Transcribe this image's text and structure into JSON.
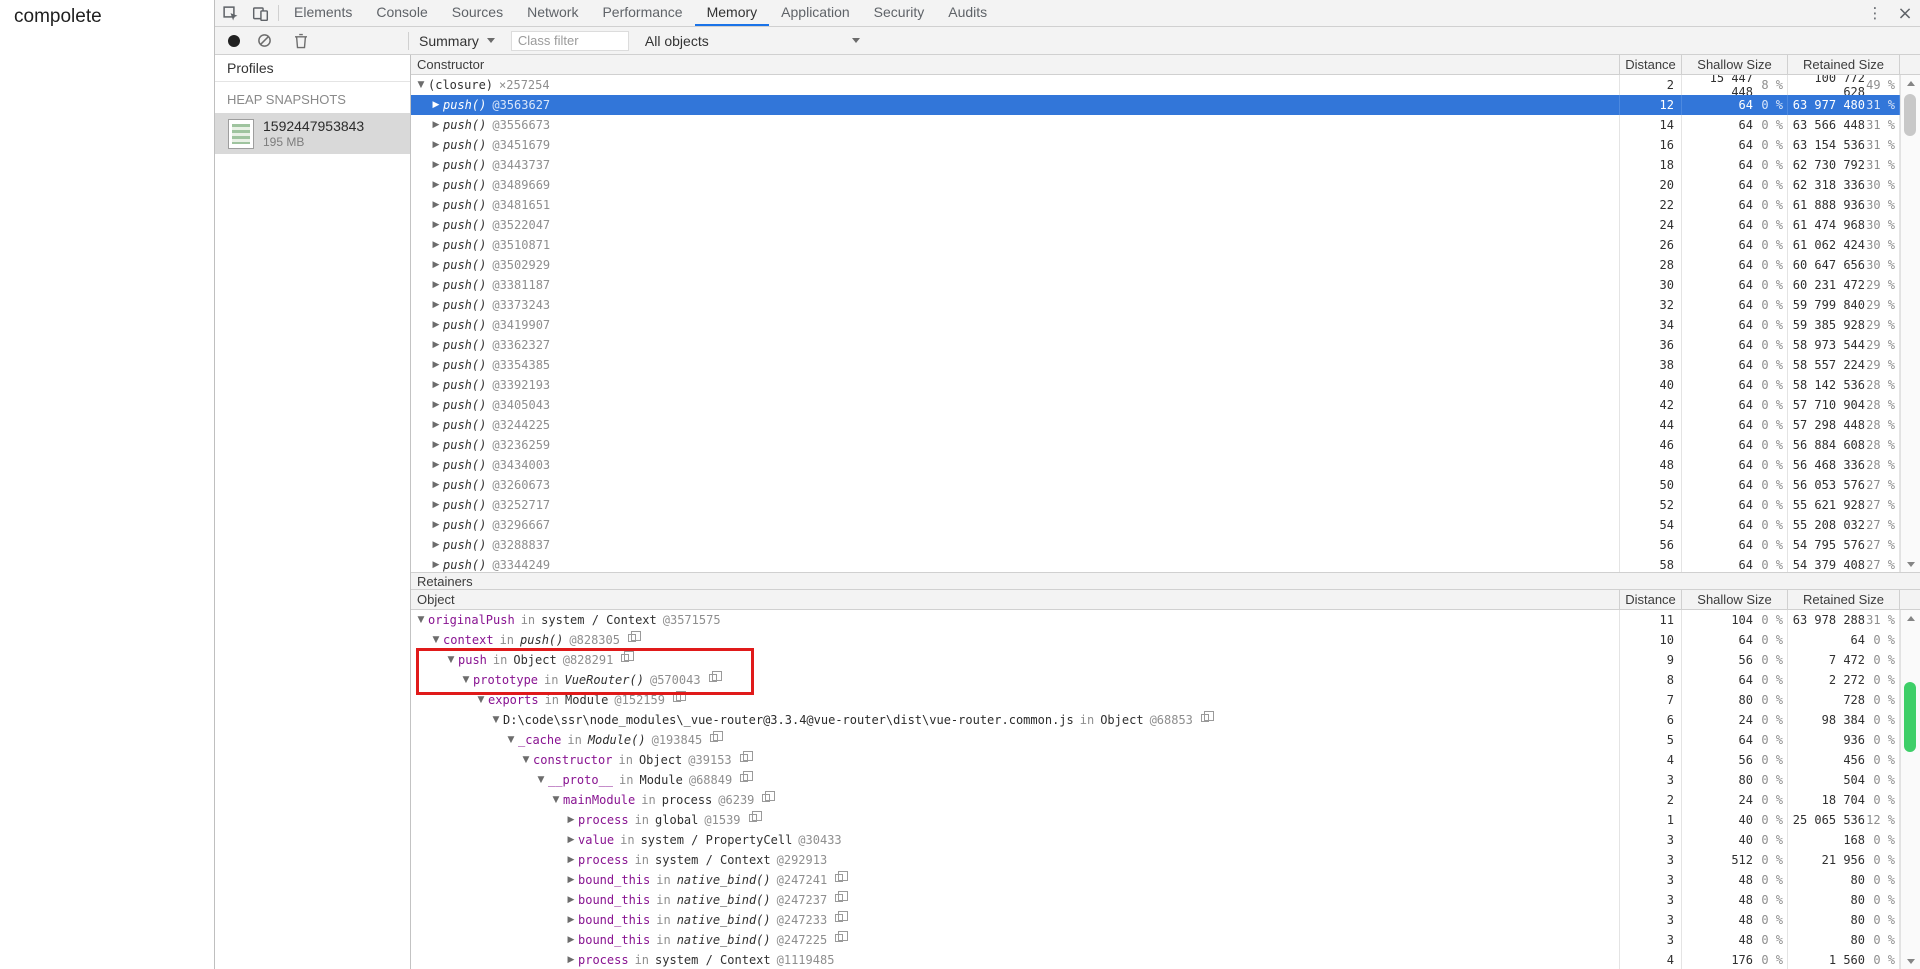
{
  "page": {
    "text": "compolete"
  },
  "colors": {
    "accent_blue": "#1a73e8",
    "selection_blue": "#3276d9",
    "property_name_purple": "#881391",
    "annotation_red": "#e01a1a",
    "scroll_thumb_green": "#3ecf68",
    "toolbar_gray": "#f3f3f3"
  },
  "icons": {
    "tabbar": [
      "inspect-icon",
      "device-toolbar-icon"
    ],
    "toolbar": [
      "record-icon",
      "clear-icon",
      "delete-icon"
    ],
    "window": [
      "menu-icon",
      "close-icon"
    ]
  },
  "devtools": {
    "tabs": [
      {
        "label": "Elements",
        "active": false
      },
      {
        "label": "Console",
        "active": false
      },
      {
        "label": "Sources",
        "active": false
      },
      {
        "label": "Network",
        "active": false
      },
      {
        "label": "Performance",
        "active": false
      },
      {
        "label": "Memory",
        "active": true
      },
      {
        "label": "Application",
        "active": false
      },
      {
        "label": "Security",
        "active": false
      },
      {
        "label": "Audits",
        "active": false
      }
    ],
    "window_controls": {
      "menu": "⋮",
      "close": "×"
    },
    "toolbar": {
      "summary_label": "Summary",
      "class_filter_placeholder": "Class filter",
      "all_objects_label": "All objects"
    },
    "sidebar": {
      "title": "Profiles",
      "section": "HEAP SNAPSHOTS",
      "snapshot": {
        "name": "1592447953843",
        "size": "195 MB"
      }
    },
    "constructor_panel": {
      "columns": [
        "Constructor",
        "Distance",
        "Shallow Size",
        "Retained Size"
      ],
      "rows": [
        {
          "marker": "▼",
          "indent": 0,
          "name": "(closure)",
          "fn": false,
          "count": "×257254",
          "id": "",
          "dist": "2",
          "shallow": "15 447 448",
          "shallow_pct": "8 %",
          "retained": "100 772 628",
          "retained_pct": "49 %",
          "selected": false
        },
        {
          "marker": "▶",
          "indent": 1,
          "name": "push()",
          "fn": true,
          "count": "",
          "id": "@3563627",
          "dist": "12",
          "shallow": "64",
          "shallow_pct": "0 %",
          "retained": "63 977 480",
          "retained_pct": "31 %",
          "selected": true
        },
        {
          "marker": "▶",
          "indent": 1,
          "name": "push()",
          "fn": true,
          "count": "",
          "id": "@3556673",
          "dist": "14",
          "shallow": "64",
          "shallow_pct": "0 %",
          "retained": "63 566 448",
          "retained_pct": "31 %",
          "selected": false
        },
        {
          "marker": "▶",
          "indent": 1,
          "name": "push()",
          "fn": true,
          "count": "",
          "id": "@3451679",
          "dist": "16",
          "shallow": "64",
          "shallow_pct": "0 %",
          "retained": "63 154 536",
          "retained_pct": "31 %",
          "selected": false
        },
        {
          "marker": "▶",
          "indent": 1,
          "name": "push()",
          "fn": true,
          "count": "",
          "id": "@3443737",
          "dist": "18",
          "shallow": "64",
          "shallow_pct": "0 %",
          "retained": "62 730 792",
          "retained_pct": "31 %",
          "selected": false
        },
        {
          "marker": "▶",
          "indent": 1,
          "name": "push()",
          "fn": true,
          "count": "",
          "id": "@3489669",
          "dist": "20",
          "shallow": "64",
          "shallow_pct": "0 %",
          "retained": "62 318 336",
          "retained_pct": "30 %",
          "selected": false
        },
        {
          "marker": "▶",
          "indent": 1,
          "name": "push()",
          "fn": true,
          "count": "",
          "id": "@3481651",
          "dist": "22",
          "shallow": "64",
          "shallow_pct": "0 %",
          "retained": "61 888 936",
          "retained_pct": "30 %",
          "selected": false
        },
        {
          "marker": "▶",
          "indent": 1,
          "name": "push()",
          "fn": true,
          "count": "",
          "id": "@3522047",
          "dist": "24",
          "shallow": "64",
          "shallow_pct": "0 %",
          "retained": "61 474 968",
          "retained_pct": "30 %",
          "selected": false
        },
        {
          "marker": "▶",
          "indent": 1,
          "name": "push()",
          "fn": true,
          "count": "",
          "id": "@3510871",
          "dist": "26",
          "shallow": "64",
          "shallow_pct": "0 %",
          "retained": "61 062 424",
          "retained_pct": "30 %",
          "selected": false
        },
        {
          "marker": "▶",
          "indent": 1,
          "name": "push()",
          "fn": true,
          "count": "",
          "id": "@3502929",
          "dist": "28",
          "shallow": "64",
          "shallow_pct": "0 %",
          "retained": "60 647 656",
          "retained_pct": "30 %",
          "selected": false
        },
        {
          "marker": "▶",
          "indent": 1,
          "name": "push()",
          "fn": true,
          "count": "",
          "id": "@3381187",
          "dist": "30",
          "shallow": "64",
          "shallow_pct": "0 %",
          "retained": "60 231 472",
          "retained_pct": "29 %",
          "selected": false
        },
        {
          "marker": "▶",
          "indent": 1,
          "name": "push()",
          "fn": true,
          "count": "",
          "id": "@3373243",
          "dist": "32",
          "shallow": "64",
          "shallow_pct": "0 %",
          "retained": "59 799 840",
          "retained_pct": "29 %",
          "selected": false
        },
        {
          "marker": "▶",
          "indent": 1,
          "name": "push()",
          "fn": true,
          "count": "",
          "id": "@3419907",
          "dist": "34",
          "shallow": "64",
          "shallow_pct": "0 %",
          "retained": "59 385 928",
          "retained_pct": "29 %",
          "selected": false
        },
        {
          "marker": "▶",
          "indent": 1,
          "name": "push()",
          "fn": true,
          "count": "",
          "id": "@3362327",
          "dist": "36",
          "shallow": "64",
          "shallow_pct": "0 %",
          "retained": "58 973 544",
          "retained_pct": "29 %",
          "selected": false
        },
        {
          "marker": "▶",
          "indent": 1,
          "name": "push()",
          "fn": true,
          "count": "",
          "id": "@3354385",
          "dist": "38",
          "shallow": "64",
          "shallow_pct": "0 %",
          "retained": "58 557 224",
          "retained_pct": "29 %",
          "selected": false
        },
        {
          "marker": "▶",
          "indent": 1,
          "name": "push()",
          "fn": true,
          "count": "",
          "id": "@3392193",
          "dist": "40",
          "shallow": "64",
          "shallow_pct": "0 %",
          "retained": "58 142 536",
          "retained_pct": "28 %",
          "selected": false
        },
        {
          "marker": "▶",
          "indent": 1,
          "name": "push()",
          "fn": true,
          "count": "",
          "id": "@3405043",
          "dist": "42",
          "shallow": "64",
          "shallow_pct": "0 %",
          "retained": "57 710 904",
          "retained_pct": "28 %",
          "selected": false
        },
        {
          "marker": "▶",
          "indent": 1,
          "name": "push()",
          "fn": true,
          "count": "",
          "id": "@3244225",
          "dist": "44",
          "shallow": "64",
          "shallow_pct": "0 %",
          "retained": "57 298 448",
          "retained_pct": "28 %",
          "selected": false
        },
        {
          "marker": "▶",
          "indent": 1,
          "name": "push()",
          "fn": true,
          "count": "",
          "id": "@3236259",
          "dist": "46",
          "shallow": "64",
          "shallow_pct": "0 %",
          "retained": "56 884 608",
          "retained_pct": "28 %",
          "selected": false
        },
        {
          "marker": "▶",
          "indent": 1,
          "name": "push()",
          "fn": true,
          "count": "",
          "id": "@3434003",
          "dist": "48",
          "shallow": "64",
          "shallow_pct": "0 %",
          "retained": "56 468 336",
          "retained_pct": "28 %",
          "selected": false
        },
        {
          "marker": "▶",
          "indent": 1,
          "name": "push()",
          "fn": true,
          "count": "",
          "id": "@3260673",
          "dist": "50",
          "shallow": "64",
          "shallow_pct": "0 %",
          "retained": "56 053 576",
          "retained_pct": "27 %",
          "selected": false
        },
        {
          "marker": "▶",
          "indent": 1,
          "name": "push()",
          "fn": true,
          "count": "",
          "id": "@3252717",
          "dist": "52",
          "shallow": "64",
          "shallow_pct": "0 %",
          "retained": "55 621 928",
          "retained_pct": "27 %",
          "selected": false
        },
        {
          "marker": "▶",
          "indent": 1,
          "name": "push()",
          "fn": true,
          "count": "",
          "id": "@3296667",
          "dist": "54",
          "shallow": "64",
          "shallow_pct": "0 %",
          "retained": "55 208 032",
          "retained_pct": "27 %",
          "selected": false
        },
        {
          "marker": "▶",
          "indent": 1,
          "name": "push()",
          "fn": true,
          "count": "",
          "id": "@3288837",
          "dist": "56",
          "shallow": "64",
          "shallow_pct": "0 %",
          "retained": "54 795 576",
          "retained_pct": "27 %",
          "selected": false
        },
        {
          "marker": "▶",
          "indent": 1,
          "name": "push()",
          "fn": true,
          "count": "",
          "id": "@3344249",
          "dist": "58",
          "shallow": "64",
          "shallow_pct": "0 %",
          "retained": "54 379 408",
          "retained_pct": "27 %",
          "selected": false
        }
      ]
    },
    "retainers_panel": {
      "title": "Retainers",
      "columns": [
        "Object",
        "Distance",
        "Shallow Size",
        "Retained Size"
      ],
      "rows": [
        {
          "marker": "▼",
          "indent": 0,
          "prop": "originalPush",
          "prop_style": "name",
          "obj": "system / Context",
          "obj_fn": false,
          "id": "@3571575",
          "reveal": false,
          "dist": "11",
          "shallow": "104",
          "shallow_pct": "0 %",
          "retained": "63 978 288",
          "retained_pct": "31 %"
        },
        {
          "marker": "▼",
          "indent": 1,
          "prop": "context",
          "prop_style": "name",
          "obj": "push()",
          "obj_fn": true,
          "id": "@828305",
          "reveal": true,
          "dist": "10",
          "shallow": "64",
          "shallow_pct": "0 %",
          "retained": "64",
          "retained_pct": "0 %"
        },
        {
          "marker": "▼",
          "indent": 2,
          "prop": "push",
          "prop_style": "name",
          "obj": "Object",
          "obj_fn": false,
          "id": "@828291",
          "reveal": true,
          "dist": "9",
          "shallow": "56",
          "shallow_pct": "0 %",
          "retained": "7 472",
          "retained_pct": "0 %"
        },
        {
          "marker": "▼",
          "indent": 3,
          "prop": "prototype",
          "prop_style": "name",
          "obj": "VueRouter()",
          "obj_fn": true,
          "id": "@570043",
          "reveal": true,
          "dist": "8",
          "shallow": "64",
          "shallow_pct": "0 %",
          "retained": "2 272",
          "retained_pct": "0 %"
        },
        {
          "marker": "▼",
          "indent": 4,
          "prop": "exports",
          "prop_style": "name",
          "obj": "Module",
          "obj_fn": false,
          "id": "@152159",
          "reveal": true,
          "dist": "7",
          "shallow": "80",
          "shallow_pct": "0 %",
          "retained": "728",
          "retained_pct": "0 %"
        },
        {
          "marker": "▼",
          "indent": 5,
          "prop": "D:\\code\\ssr\\node_modules\\_vue-router@3.3.4@vue-router\\dist\\vue-router.common.js",
          "prop_style": "path",
          "obj": "Object",
          "obj_fn": false,
          "id": "@68853",
          "reveal": true,
          "dist": "6",
          "shallow": "24",
          "shallow_pct": "0 %",
          "retained": "98 384",
          "retained_pct": "0 %"
        },
        {
          "marker": "▼",
          "indent": 6,
          "prop": "_cache",
          "prop_style": "name",
          "obj": "Module()",
          "obj_fn": true,
          "id": "@193845",
          "reveal": true,
          "dist": "5",
          "shallow": "64",
          "shallow_pct": "0 %",
          "retained": "936",
          "retained_pct": "0 %"
        },
        {
          "marker": "▼",
          "indent": 7,
          "prop": "constructor",
          "prop_style": "name",
          "obj": "Object",
          "obj_fn": false,
          "id": "@39153",
          "reveal": true,
          "dist": "4",
          "shallow": "56",
          "shallow_pct": "0 %",
          "retained": "456",
          "retained_pct": "0 %"
        },
        {
          "marker": "▼",
          "indent": 8,
          "prop": "__proto__",
          "prop_style": "name",
          "obj": "Module",
          "obj_fn": false,
          "id": "@68849",
          "reveal": true,
          "dist": "3",
          "shallow": "80",
          "shallow_pct": "0 %",
          "retained": "504",
          "retained_pct": "0 %"
        },
        {
          "marker": "▼",
          "indent": 9,
          "prop": "mainModule",
          "prop_style": "name",
          "obj": "process",
          "obj_fn": false,
          "id": "@6239",
          "reveal": true,
          "dist": "2",
          "shallow": "24",
          "shallow_pct": "0 %",
          "retained": "18 704",
          "retained_pct": "0 %"
        },
        {
          "marker": "▶",
          "indent": 10,
          "prop": "process",
          "prop_style": "name",
          "obj": "global",
          "obj_fn": false,
          "id": "@1539",
          "reveal": true,
          "dist": "1",
          "shallow": "40",
          "shallow_pct": "0 %",
          "retained": "25 065 536",
          "retained_pct": "12 %"
        },
        {
          "marker": "▶",
          "indent": 10,
          "prop": "value",
          "prop_style": "name",
          "obj": "system / PropertyCell",
          "obj_fn": false,
          "id": "@30433",
          "reveal": false,
          "dist": "3",
          "shallow": "40",
          "shallow_pct": "0 %",
          "retained": "168",
          "retained_pct": "0 %"
        },
        {
          "marker": "▶",
          "indent": 10,
          "prop": "process",
          "prop_style": "name",
          "obj": "system / Context",
          "obj_fn": false,
          "id": "@292913",
          "reveal": false,
          "dist": "3",
          "shallow": "512",
          "shallow_pct": "0 %",
          "retained": "21 956",
          "retained_pct": "0 %"
        },
        {
          "marker": "▶",
          "indent": 10,
          "prop": "bound_this",
          "prop_style": "name",
          "obj": "native_bind()",
          "obj_fn": true,
          "id": "@247241",
          "reveal": true,
          "dist": "3",
          "shallow": "48",
          "shallow_pct": "0 %",
          "retained": "80",
          "retained_pct": "0 %"
        },
        {
          "marker": "▶",
          "indent": 10,
          "prop": "bound_this",
          "prop_style": "name",
          "obj": "native_bind()",
          "obj_fn": true,
          "id": "@247237",
          "reveal": true,
          "dist": "3",
          "shallow": "48",
          "shallow_pct": "0 %",
          "retained": "80",
          "retained_pct": "0 %"
        },
        {
          "marker": "▶",
          "indent": 10,
          "prop": "bound_this",
          "prop_style": "name",
          "obj": "native_bind()",
          "obj_fn": true,
          "id": "@247233",
          "reveal": true,
          "dist": "3",
          "shallow": "48",
          "shallow_pct": "0 %",
          "retained": "80",
          "retained_pct": "0 %"
        },
        {
          "marker": "▶",
          "indent": 10,
          "prop": "bound_this",
          "prop_style": "name",
          "obj": "native_bind()",
          "obj_fn": true,
          "id": "@247225",
          "reveal": true,
          "dist": "3",
          "shallow": "48",
          "shallow_pct": "0 %",
          "retained": "80",
          "retained_pct": "0 %"
        },
        {
          "marker": "▶",
          "indent": 10,
          "prop": "process",
          "prop_style": "name",
          "obj": "system / Context",
          "obj_fn": false,
          "id": "@1119485",
          "reveal": false,
          "dist": "4",
          "shallow": "176",
          "shallow_pct": "0 %",
          "retained": "1 560",
          "retained_pct": "0 %"
        }
      ]
    }
  }
}
